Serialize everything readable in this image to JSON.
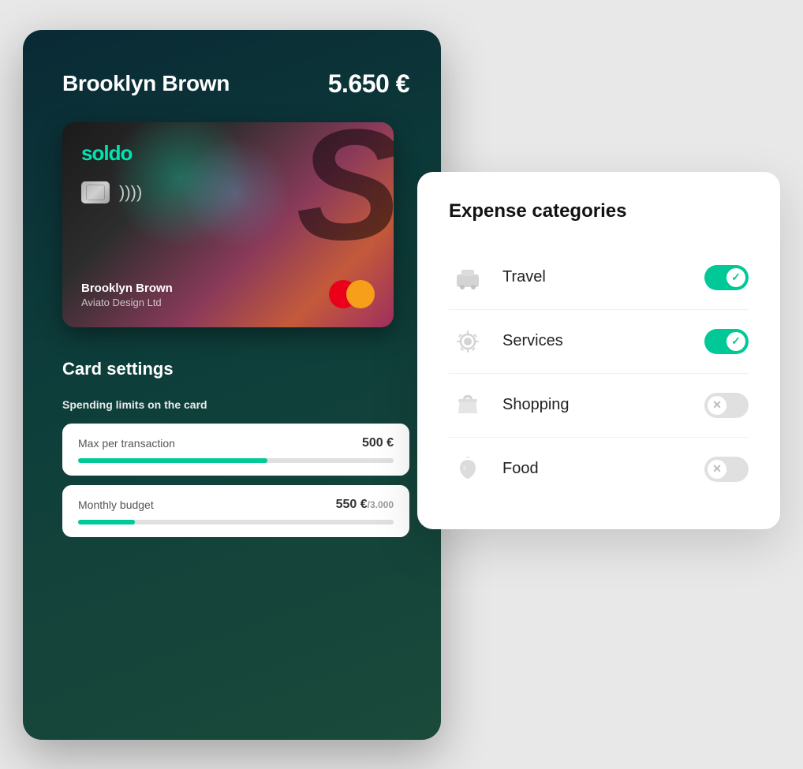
{
  "card_panel": {
    "owner_name": "Brooklyn Brown",
    "balance": "5.650 €",
    "soldo_logo": "sol",
    "soldo_logo_accent": "do",
    "big_letter": "S",
    "card_holder_name": "Brooklyn Brown",
    "card_company": "Aviato Design Ltd",
    "card_settings_title": "Card settings",
    "spending_limits_title": "Spending limits on the card",
    "limits": [
      {
        "label": "Max per transaction",
        "value": "500 €",
        "progress": 60,
        "bar_width": "60%"
      },
      {
        "label": "Monthly budget",
        "value": "550 €",
        "subvalue": "/3.000",
        "progress": 18,
        "bar_width": "18%"
      }
    ]
  },
  "expense_panel": {
    "title": "Expense categories",
    "categories": [
      {
        "name": "Travel",
        "icon": "travel",
        "enabled": true
      },
      {
        "name": "Services",
        "icon": "services",
        "enabled": true
      },
      {
        "name": "Shopping",
        "icon": "shopping",
        "enabled": false
      },
      {
        "name": "Food",
        "icon": "food",
        "enabled": false
      }
    ]
  }
}
